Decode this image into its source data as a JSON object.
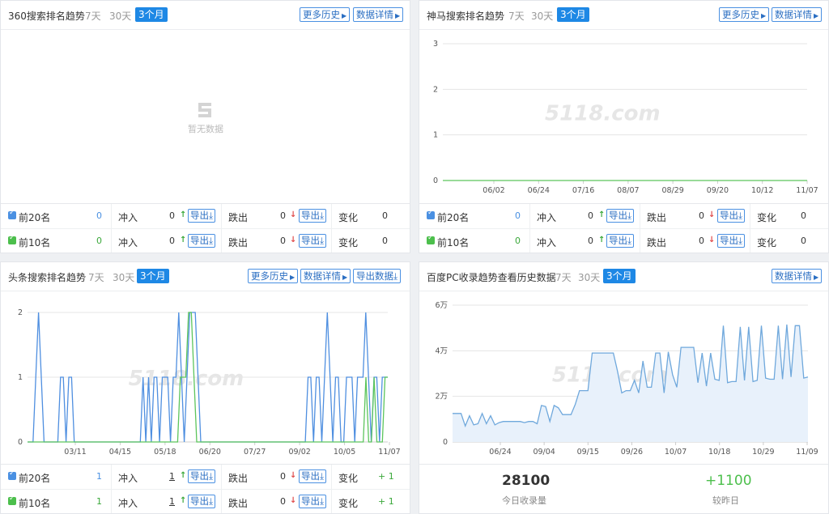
{
  "colors": {
    "accent": "#1e88e5",
    "blue_line": "#4f8fe0",
    "green_line": "#5cc55c",
    "up": "#3aa83a",
    "down": "#e04b4b",
    "area_fill": "#e8f1fb"
  },
  "watermark": "5118.com",
  "panel_360": {
    "title": "360搜索排名趋势",
    "ranges": [
      "7天",
      "30天",
      "3个月"
    ],
    "btn_history": "更多历史",
    "btn_detail": "数据详情",
    "empty_text": "暂无数据",
    "stats": {
      "top20_label": "前20名",
      "top20_value": "0",
      "top10_label": "前10名",
      "top10_value": "0",
      "in_label": "冲入",
      "out_label": "跌出",
      "change_label": "变化",
      "export_label": "导出",
      "row1": {
        "in": "0",
        "out": "0",
        "change": "0"
      },
      "row2": {
        "in": "0",
        "out": "0",
        "change": "0"
      }
    }
  },
  "panel_shenma": {
    "title": "神马搜索排名趋势",
    "ranges": [
      "7天",
      "30天",
      "3个月"
    ],
    "btn_history": "更多历史",
    "btn_detail": "数据详情",
    "stats": {
      "top20_label": "前20名",
      "top20_value": "0",
      "top10_label": "前10名",
      "top10_value": "0",
      "in_label": "冲入",
      "out_label": "跌出",
      "change_label": "变化",
      "export_label": "导出",
      "row1": {
        "in": "0",
        "out": "0",
        "change": "0"
      },
      "row2": {
        "in": "0",
        "out": "0",
        "change": "0"
      }
    }
  },
  "panel_toutiao": {
    "title": "头条搜索排名趋势",
    "ranges": [
      "7天",
      "30天",
      "3个月"
    ],
    "btn_history": "更多历史",
    "btn_detail": "数据详情",
    "btn_export": "导出数据",
    "stats": {
      "top20_label": "前20名",
      "top20_value": "1",
      "top10_label": "前10名",
      "top10_value": "1",
      "in_label": "冲入",
      "out_label": "跌出",
      "change_label": "变化",
      "export_label": "导出",
      "row1": {
        "in": "1",
        "out": "0",
        "change": "+ 1"
      },
      "row2": {
        "in": "1",
        "out": "0",
        "change": "+ 1"
      }
    }
  },
  "panel_baidu": {
    "title": "百度PC收录趋势查看历史数据",
    "ranges": [
      "7天",
      "30天",
      "3个月"
    ],
    "btn_detail": "数据详情",
    "today_value": "28100",
    "today_label": "今日收录量",
    "diff_value": "+1100",
    "diff_label": "较昨日"
  },
  "chart_data": [
    {
      "type": "line",
      "ylim": [
        0,
        3
      ],
      "y_ticks": [
        "0",
        "1",
        "2",
        "3"
      ],
      "categories": [
        "06/02",
        "06/24",
        "07/16",
        "08/07",
        "08/29",
        "09/20",
        "10/12",
        "11/07"
      ],
      "series": [
        {
          "color": "#5cc55c",
          "values": [
            0,
            0,
            0,
            0,
            0,
            0,
            0,
            0
          ]
        }
      ]
    },
    {
      "type": "line",
      "ylim": [
        0,
        2
      ],
      "y_ticks": [
        "0",
        "1",
        "2"
      ],
      "categories": [
        "03/11",
        "04/15",
        "05/18",
        "06/20",
        "07/27",
        "09/02",
        "10/05",
        "11/07"
      ],
      "series": [
        {
          "color": "#4f8fe0",
          "values": [
            0,
            0,
            0,
            1,
            2,
            1,
            0,
            0,
            0,
            0,
            0,
            0,
            1,
            1,
            0,
            1,
            1,
            0,
            0,
            0,
            0,
            0,
            0,
            0,
            0,
            0,
            0,
            0,
            0,
            0,
            0,
            0,
            0,
            0,
            0,
            0,
            0,
            0,
            0,
            0,
            0,
            0,
            1,
            0,
            1,
            0,
            1,
            1,
            0,
            1,
            1,
            1,
            0,
            1,
            1,
            2,
            1,
            0,
            1,
            2,
            2,
            2,
            1,
            0,
            0,
            0,
            0,
            0,
            0,
            0,
            0,
            0,
            0,
            0,
            0,
            0,
            0,
            0,
            0,
            0,
            0,
            0,
            0,
            0,
            0,
            0,
            0,
            0,
            0,
            0,
            0,
            0,
            0,
            0,
            0,
            0,
            0,
            0,
            0,
            0,
            0,
            0,
            1,
            1,
            0,
            1,
            1,
            0,
            1,
            2,
            1,
            0,
            1,
            1,
            0,
            0,
            1,
            1,
            1,
            0,
            1,
            1,
            1,
            2,
            1,
            0,
            1,
            1,
            0,
            1,
            1,
            1
          ]
        },
        {
          "color": "#5cc55c",
          "values": [
            0,
            0,
            0,
            0,
            0,
            0,
            0,
            0,
            0,
            0,
            0,
            0,
            0,
            0,
            0,
            0,
            0,
            0,
            0,
            0,
            0,
            0,
            0,
            0,
            0,
            0,
            0,
            0,
            0,
            0,
            0,
            0,
            0,
            0,
            0,
            0,
            0,
            0,
            0,
            0,
            0,
            0,
            0,
            0,
            0,
            0,
            0,
            0,
            0,
            0,
            0,
            0,
            0,
            0,
            0,
            0,
            1,
            1,
            1,
            2,
            2,
            1,
            0,
            0,
            0,
            0,
            0,
            0,
            0,
            0,
            0,
            0,
            0,
            0,
            0,
            0,
            0,
            0,
            0,
            0,
            0,
            0,
            0,
            0,
            0,
            0,
            0,
            0,
            0,
            0,
            0,
            0,
            0,
            0,
            0,
            0,
            0,
            0,
            0,
            0,
            0,
            0,
            0,
            0,
            0,
            0,
            0,
            0,
            0,
            0,
            0,
            0,
            0,
            0,
            0,
            0,
            0,
            0,
            0,
            0,
            0,
            0,
            0,
            0,
            1,
            0,
            0,
            1,
            0,
            0,
            0,
            1,
            1
          ]
        }
      ]
    },
    {
      "type": "area",
      "ylim": [
        0,
        60000
      ],
      "y_ticks": [
        "0",
        "2万",
        "4万",
        "6万"
      ],
      "categories": [
        "06/24",
        "09/04",
        "09/15",
        "09/26",
        "10/07",
        "10/18",
        "10/29",
        "11/09"
      ],
      "series": [
        {
          "color": "#6fa8dc",
          "values": [
            12500,
            12500,
            12500,
            7000,
            11500,
            7500,
            8000,
            12500,
            8000,
            11500,
            7500,
            8500,
            9000,
            9000,
            9000,
            9000,
            9000,
            8500,
            9000,
            9000,
            8000,
            16000,
            15500,
            9000,
            16000,
            15000,
            12000,
            12000,
            12000,
            16500,
            22500,
            22500,
            22500,
            39000,
            39000,
            39000,
            39000,
            39000,
            39000,
            31000,
            21500,
            22500,
            22500,
            27000,
            21500,
            35500,
            24000,
            24000,
            39000,
            39000,
            21500,
            39500,
            29500,
            24000,
            41500,
            41500,
            41500,
            41500,
            26000,
            39000,
            24500,
            39000,
            27500,
            27000,
            51000,
            26000,
            26500,
            26500,
            50500,
            27000,
            50500,
            26500,
            27000,
            51000,
            28000,
            27500,
            27500,
            51000,
            27500,
            51500,
            28500,
            51000,
            51000,
            28000,
            28500
          ]
        }
      ]
    }
  ]
}
